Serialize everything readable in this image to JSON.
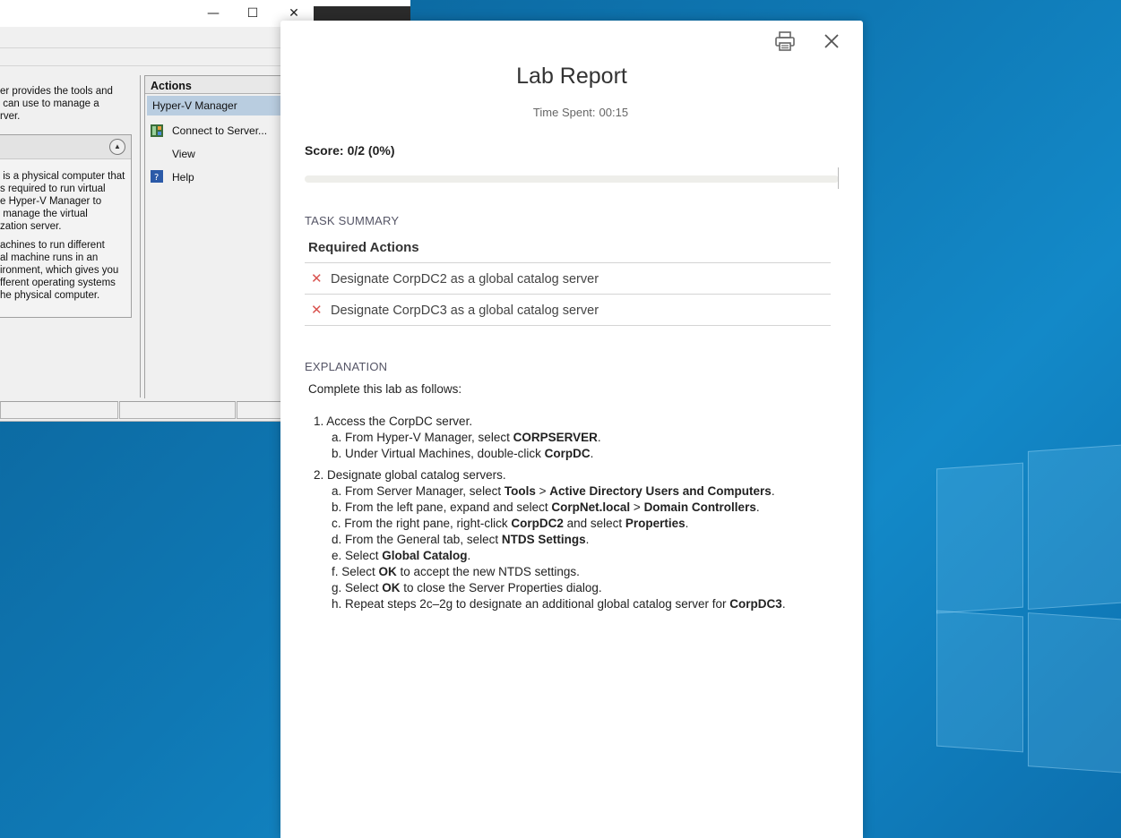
{
  "background_window": {
    "title_buttons": [
      "—",
      "☐",
      "✕"
    ],
    "left_texts": [
      "er provides the tools and\n can use to manage a\nrver.",
      " is a physical computer that\ns required to run virtual\ne Hyper-V Manager to\n manage the virtual\nzation server.",
      "achines to run different\nal machine runs in an\nironment, which gives you\nfferent operating systems\nhe physical computer."
    ],
    "actions": {
      "header": "Actions",
      "selected": "Hyper-V Manager",
      "items": [
        "Connect to Server...",
        "View",
        "Help"
      ]
    }
  },
  "modal": {
    "title": "Lab Report",
    "time_spent_label": "Time Spent:",
    "time_spent_value": "00:15",
    "score_label": "Score:",
    "score_value": "0/2 (0%)",
    "score_fraction": 0,
    "task_summary_heading": "TASK SUMMARY",
    "required_actions_heading": "Required Actions",
    "tasks": [
      {
        "status": "failed",
        "text": "Designate CorpDC2 as a global catalog server"
      },
      {
        "status": "failed",
        "text": "Designate CorpDC3 as a global catalog server"
      }
    ],
    "explanation_heading": "EXPLANATION",
    "intro": "Complete this lab as follows:",
    "steps": [
      {
        "title": "1. Access the CorpDC server.",
        "subs": [
          {
            "prefix": "a. From Hyper-V Manager, select ",
            "bold": "CORPSERVER",
            "suffix": "."
          },
          {
            "prefix": "b. Under Virtual Machines, double-click ",
            "bold": "CorpDC",
            "suffix": "."
          }
        ]
      },
      {
        "title": "2. Designate global catalog servers.",
        "subs": [
          {
            "prefix": "a. From Server Manager, select ",
            "bold": "Tools",
            "mid": " > ",
            "bold2": "Active Directory Users and Computers",
            "suffix": "."
          },
          {
            "prefix": "b. From the left pane, expand and select ",
            "bold": "CorpNet.local",
            "mid": " > ",
            "bold2": "Domain Controllers",
            "suffix": "."
          },
          {
            "prefix": "c. From the right pane, right-click ",
            "bold": "CorpDC2",
            "mid": " and select ",
            "bold2": "Properties",
            "suffix": "."
          },
          {
            "prefix": "d. From the General tab, select ",
            "bold": "NTDS Settings",
            "suffix": "."
          },
          {
            "prefix": "e. Select ",
            "bold": "Global Catalog",
            "suffix": "."
          },
          {
            "prefix": "f. Select ",
            "bold": "OK",
            "suffix": " to accept the new NTDS settings."
          },
          {
            "prefix": "g. Select ",
            "bold": "OK",
            "suffix": " to close the Server Properties dialog."
          },
          {
            "prefix": "h. Repeat steps 2c–2g to designate an additional global catalog server for ",
            "bold": "CorpDC3",
            "suffix": "."
          }
        ]
      }
    ]
  },
  "colors": {
    "fail_x": "#d9534f",
    "desktop": "#0f78b4"
  },
  "icons": {
    "print": "print-icon",
    "close": "close-icon"
  }
}
